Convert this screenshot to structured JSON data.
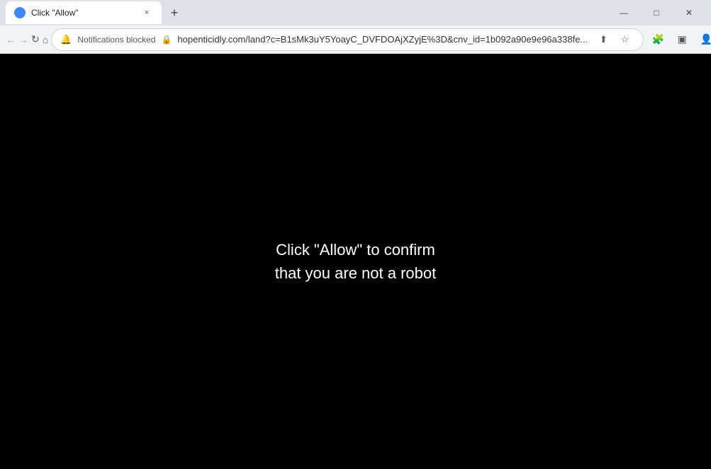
{
  "titlebar": {
    "tab": {
      "title": "Click \"Allow\"",
      "close_label": "×"
    },
    "new_tab_label": "+",
    "window_controls": {
      "minimize": "—",
      "maximize": "□",
      "close": "✕"
    }
  },
  "toolbar": {
    "back_label": "←",
    "forward_label": "→",
    "reload_label": "↻",
    "home_label": "⌂",
    "notifications_blocked": "Notifications blocked",
    "url": "hopenticidly.com/land?c=B1sMk3uY5YoayC_DVFDOAjXZyjE%3D&cnv_id=1b092a90e9e96a338fe...",
    "share_label": "⬆",
    "star_label": "☆",
    "extensions_label": "🧩",
    "sidebar_label": "▣",
    "profile_label": "👤",
    "menu_label": "⋮"
  },
  "page": {
    "message_line1": "Click \"Allow\" to confirm",
    "message_line2": "that you are not a robot"
  }
}
